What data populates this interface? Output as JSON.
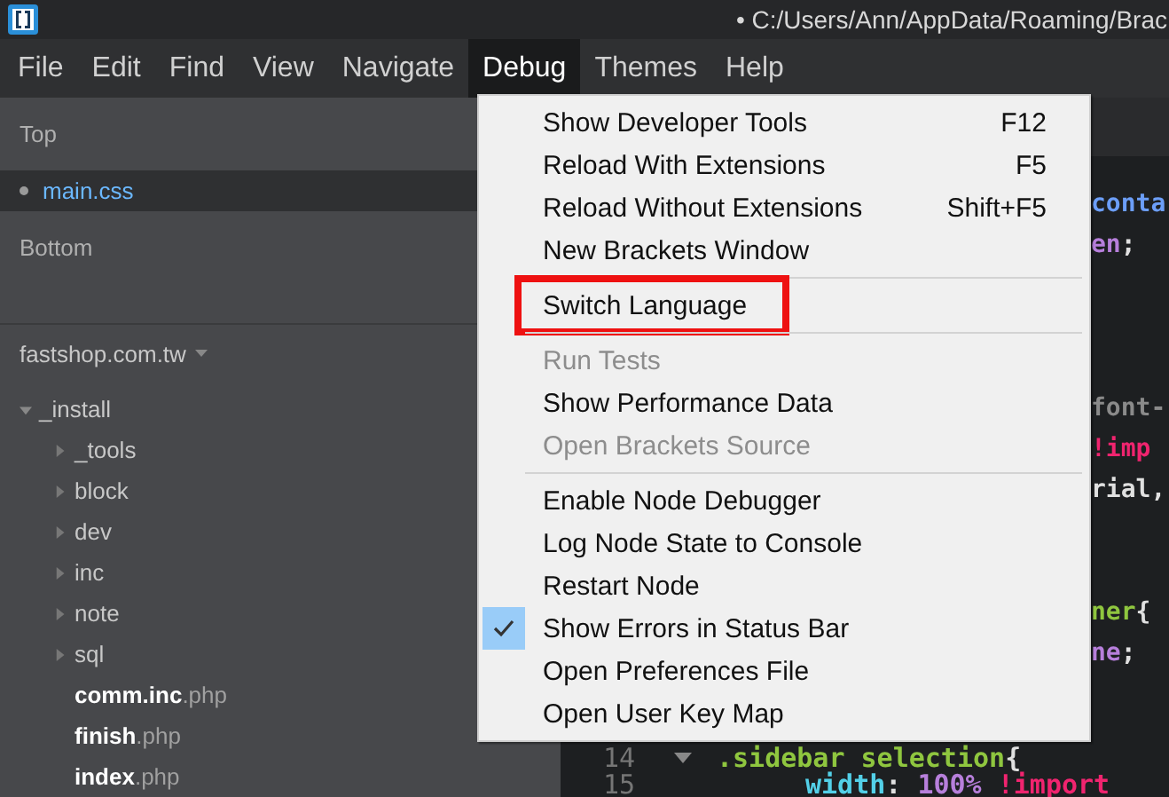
{
  "window": {
    "title": "• C:/Users/Ann/AppData/Roaming/Brac"
  },
  "menubar": [
    {
      "label": "File",
      "selected": false
    },
    {
      "label": "Edit",
      "selected": false
    },
    {
      "label": "Find",
      "selected": false
    },
    {
      "label": "View",
      "selected": false
    },
    {
      "label": "Navigate",
      "selected": false
    },
    {
      "label": "Debug",
      "selected": true
    },
    {
      "label": "Themes",
      "selected": false
    },
    {
      "label": "Help",
      "selected": false
    }
  ],
  "sidebar": {
    "working_sets": [
      {
        "title": "Top",
        "files": [
          {
            "name": "main.css",
            "selected": true
          }
        ]
      },
      {
        "title": "Bottom"
      }
    ],
    "project": {
      "name": "fastshop.com.tw",
      "tree": [
        {
          "name": "_install",
          "kind": "folder",
          "expanded": true,
          "children": [
            {
              "name": "_tools",
              "kind": "folder",
              "expanded": false
            },
            {
              "name": "block",
              "kind": "folder",
              "expanded": false
            },
            {
              "name": "dev",
              "kind": "folder",
              "expanded": false
            },
            {
              "name": "inc",
              "kind": "folder",
              "expanded": false
            },
            {
              "name": "note",
              "kind": "folder",
              "expanded": false
            },
            {
              "name": "sql",
              "kind": "folder",
              "expanded": false
            },
            {
              "name": "comm.inc",
              "ext": ".php",
              "kind": "file"
            },
            {
              "name": "finish",
              "ext": ".php",
              "kind": "file"
            },
            {
              "name": "index",
              "ext": ".php",
              "kind": "file"
            }
          ]
        }
      ]
    }
  },
  "editor": {
    "lines": [
      {
        "kind": "fragment",
        "tokens": [
          {
            "text": "conta",
            "kind": "selector"
          }
        ]
      },
      {
        "kind": "fragment",
        "tokens": [
          {
            "text": "en",
            "kind": "value"
          },
          {
            "text": ";",
            "kind": "plain"
          }
        ]
      },
      {
        "kind": "blank"
      },
      {
        "kind": "blank"
      },
      {
        "kind": "blank"
      },
      {
        "kind": "fragment",
        "tokens": [
          {
            "text": "font-",
            "kind": "comment"
          }
        ]
      },
      {
        "kind": "fragment",
        "tokens": [
          {
            "text": "!imp",
            "kind": "important"
          }
        ]
      },
      {
        "kind": "fragment",
        "tokens": [
          {
            "text": "rial,",
            "kind": "plain"
          }
        ]
      },
      {
        "kind": "blank"
      },
      {
        "kind": "blank"
      },
      {
        "kind": "fragment",
        "tokens": [
          {
            "text": "ner",
            "kind": "tag"
          },
          {
            "text": "{",
            "kind": "plain"
          }
        ]
      },
      {
        "kind": "fragment",
        "tokens": [
          {
            "text": "ne",
            "kind": "value"
          },
          {
            "text": ";",
            "kind": "plain"
          }
        ]
      },
      {
        "kind": "blank"
      },
      {
        "kind": "rule",
        "number": "14",
        "tokens": [
          {
            "text": ".sidebar selection",
            "kind": "tag"
          },
          {
            "text": "{",
            "kind": "plain"
          }
        ]
      },
      {
        "kind": "property",
        "number": "15",
        "tokens": [
          {
            "text": "width",
            "kind": "property"
          },
          {
            "text": ": ",
            "kind": "plain"
          },
          {
            "text": "100%",
            "kind": "value"
          },
          {
            "text": " !import",
            "kind": "important"
          }
        ]
      }
    ]
  },
  "menu": {
    "items": [
      {
        "label": "Show Developer Tools",
        "shortcut": "F12",
        "disabled": false,
        "checked": false,
        "highlighted": false
      },
      {
        "label": "Reload With Extensions",
        "shortcut": "F5",
        "disabled": false,
        "checked": false,
        "highlighted": false
      },
      {
        "label": "Reload Without Extensions",
        "shortcut": "Shift+F5",
        "disabled": false,
        "checked": false,
        "highlighted": false
      },
      {
        "label": "New Brackets Window",
        "disabled": false,
        "checked": false,
        "highlighted": false
      },
      {
        "kind": "separator"
      },
      {
        "label": "Switch Language",
        "disabled": false,
        "checked": false,
        "highlighted": true
      },
      {
        "kind": "separator"
      },
      {
        "label": "Run Tests",
        "disabled": true,
        "checked": false,
        "highlighted": false
      },
      {
        "label": "Show Performance Data",
        "disabled": false,
        "checked": false,
        "highlighted": false
      },
      {
        "label": "Open Brackets Source",
        "disabled": true,
        "checked": false,
        "highlighted": false
      },
      {
        "kind": "separator"
      },
      {
        "label": "Enable Node Debugger",
        "disabled": false,
        "checked": false,
        "highlighted": false
      },
      {
        "label": "Log Node State to Console",
        "disabled": false,
        "checked": false,
        "highlighted": false
      },
      {
        "label": "Restart Node",
        "disabled": false,
        "checked": false,
        "highlighted": false
      },
      {
        "label": "Show Errors in Status Bar",
        "disabled": false,
        "checked": true,
        "highlighted": false
      },
      {
        "label": "Open Preferences File",
        "disabled": false,
        "checked": false,
        "highlighted": false
      },
      {
        "label": "Open User Key Map",
        "disabled": false,
        "checked": false,
        "highlighted": false
      }
    ]
  }
}
